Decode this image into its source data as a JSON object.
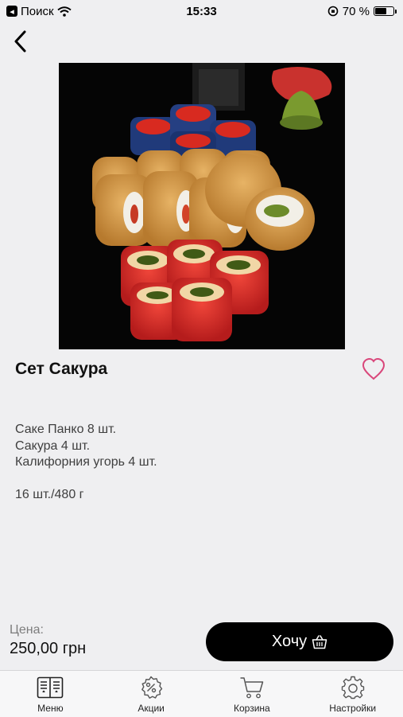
{
  "status_bar": {
    "back_app_label": "Поиск",
    "time": "15:33",
    "battery_text": "70 %",
    "battery_level": 0.7
  },
  "product": {
    "title": "Сет Сакура",
    "composition": [
      "Саке Панко 8 шт.",
      "Сакура 4 шт.",
      "Калифорния угорь 4 шт."
    ],
    "weight": "16 шт./480 г"
  },
  "price": {
    "label": "Цена:",
    "value": "250,00 грн"
  },
  "actions": {
    "want_label": "Хочу"
  },
  "tab_bar": {
    "items": [
      {
        "label": "Меню",
        "icon": "menu-book-icon"
      },
      {
        "label": "Акции",
        "icon": "discount-badge-icon"
      },
      {
        "label": "Корзина",
        "icon": "cart-icon"
      },
      {
        "label": "Настройки",
        "icon": "gear-icon"
      }
    ]
  },
  "colors": {
    "background": "#efeff1",
    "accent_button": "#000000",
    "heart": "#d9467a"
  }
}
